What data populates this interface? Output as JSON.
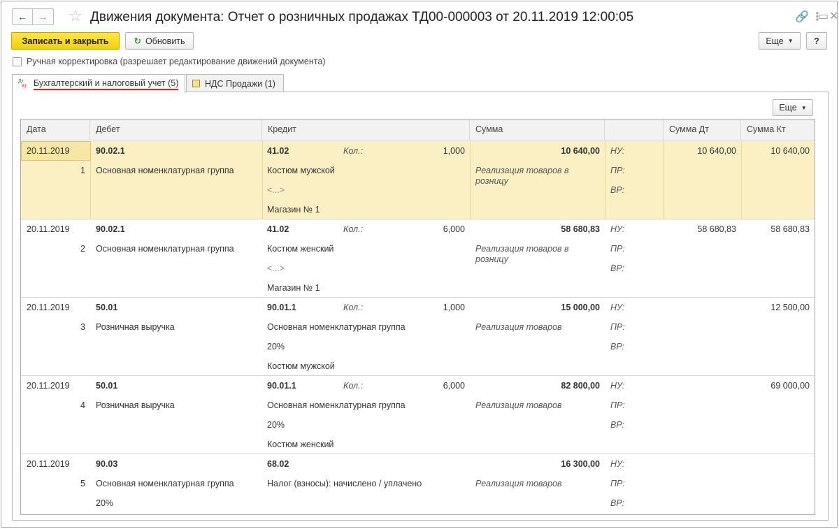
{
  "window": {
    "title": "Движения документа: Отчет о розничных продажах ТД00-000003 от 20.11.2019 12:00:05",
    "back_icon": "←",
    "forward_icon": "→",
    "star_icon": "☆",
    "link_icon": "🔗",
    "menu_icon": "⋮",
    "maximize_icon": "▭",
    "close_icon": "✕"
  },
  "toolbar": {
    "save_close": "Записать и закрыть",
    "refresh": "Обновить",
    "refresh_icon": "↻",
    "more": "Еще",
    "help": "?"
  },
  "manual": {
    "label": "Ручная корректировка (разрешает редактирование движений документа)"
  },
  "tabs": [
    {
      "label": "Бухгалтерский и налоговый учет (5)",
      "icon_top": "Дт",
      "icon_bottom": "Кт"
    },
    {
      "label": "НДС Продажи (1)"
    }
  ],
  "panel": {
    "more": "Еще"
  },
  "columns": {
    "date": "Дата",
    "debit": "Дебет",
    "credit": "Кредит",
    "sum": "Сумма",
    "blank": "",
    "sum_dt": "Сумма Дт",
    "sum_kt": "Сумма Кт"
  },
  "rows": [
    {
      "date": "20.11.2019",
      "num": "1",
      "debit": "90.02.1",
      "debit_sub": [
        "Основная номенклатурная группа"
      ],
      "credit": "41.02",
      "qty_label": "Кол.:",
      "qty": "1,000",
      "credit_sub": [
        "Костюм мужской",
        "<...>",
        "Магазин № 1"
      ],
      "sum": "10 640,00",
      "desc": "Реализация товаров в розницу",
      "nu": "НУ:",
      "pr": "ПР:",
      "vr": "ВР:",
      "sum_dt": "10 640,00",
      "sum_kt": "10 640,00"
    },
    {
      "date": "20.11.2019",
      "num": "2",
      "debit": "90.02.1",
      "debit_sub": [
        "Основная номенклатурная группа"
      ],
      "credit": "41.02",
      "qty_label": "Кол.:",
      "qty": "6,000",
      "credit_sub": [
        "Костюм женский",
        "<...>",
        "Магазин № 1"
      ],
      "sum": "58 680,83",
      "desc": "Реализация товаров в розницу",
      "nu": "НУ:",
      "pr": "ПР:",
      "vr": "ВР:",
      "sum_dt": "58 680,83",
      "sum_kt": "58 680,83"
    },
    {
      "date": "20.11.2019",
      "num": "3",
      "debit": "50.01",
      "debit_sub": [
        "Розничная выручка"
      ],
      "credit": "90.01.1",
      "qty_label": "Кол.:",
      "qty": "1,000",
      "credit_sub": [
        "Основная номенклатурная группа",
        "20%",
        "Костюм мужской"
      ],
      "sum": "15 000,00",
      "desc": "Реализация товаров",
      "nu": "НУ:",
      "pr": "ПР:",
      "vr": "ВР:",
      "sum_dt": "",
      "sum_kt": "12 500,00"
    },
    {
      "date": "20.11.2019",
      "num": "4",
      "debit": "50.01",
      "debit_sub": [
        "Розничная выручка"
      ],
      "credit": "90.01.1",
      "qty_label": "Кол.:",
      "qty": "6,000",
      "credit_sub": [
        "Основная номенклатурная группа",
        "20%",
        "Костюм женский"
      ],
      "sum": "82 800,00",
      "desc": "Реализация товаров",
      "nu": "НУ:",
      "pr": "ПР:",
      "vr": "ВР:",
      "sum_dt": "",
      "sum_kt": "69 000,00"
    },
    {
      "date": "20.11.2019",
      "num": "5",
      "debit": "90.03",
      "debit_sub": [
        "Основная номенклатурная группа",
        "20%"
      ],
      "credit": "68.02",
      "qty_label": "",
      "qty": "",
      "credit_sub": [
        "Налог (взносы): начислено / уплачено"
      ],
      "sum": "16 300,00",
      "desc": "Реализация товаров",
      "nu": "НУ:",
      "pr": "ПР:",
      "vr": "ВР:",
      "sum_dt": "",
      "sum_kt": ""
    }
  ]
}
